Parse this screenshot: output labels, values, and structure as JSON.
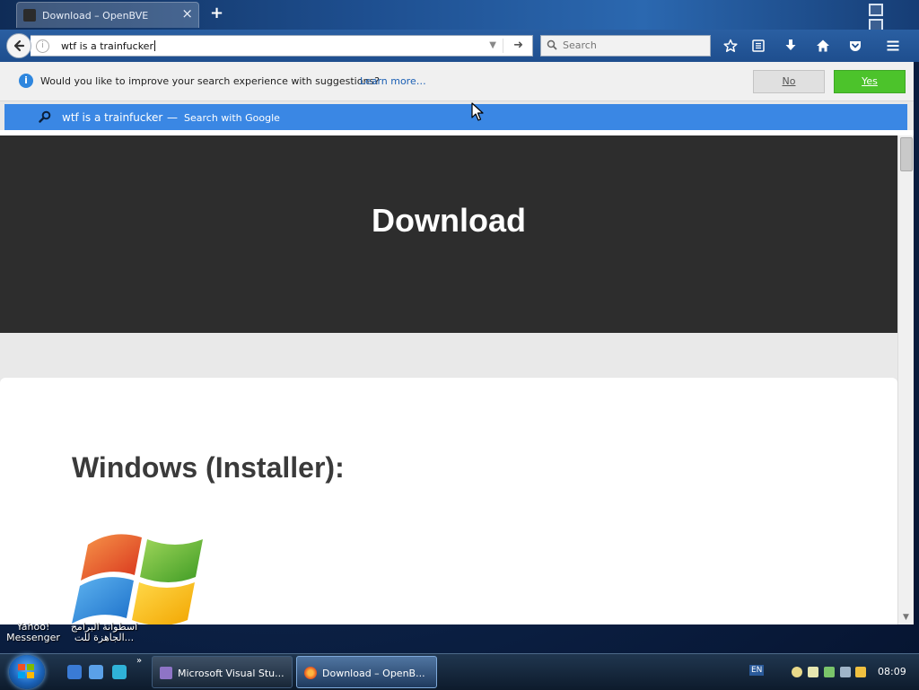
{
  "browser": {
    "tab_title": "Download – OpenBVE",
    "tab_close_glyph": "×",
    "new_tab_glyph": "+",
    "url_text": "wtf is a trainfucker",
    "search_placeholder": "Search",
    "toolbar_icons": [
      "star-bookmark-icon",
      "reading-list-icon",
      "downloads-icon",
      "home-icon",
      "pocket-icon",
      "menu-icon"
    ]
  },
  "notification": {
    "message": "Would you like to improve your search experience with suggestions?",
    "learn_more": "Learn more…",
    "no_label": "No",
    "yes_label": "Yes"
  },
  "suggestion": {
    "query": "wtf is a trainfucker",
    "separator": "—",
    "engine_text": "Search with Google"
  },
  "page": {
    "hero_title": "Download",
    "section_title": "Windows (Installer):"
  },
  "desktop": {
    "icon_labels": [
      {
        "line1": "Yahoo!",
        "line2": "Messenger"
      },
      {
        "line1": "اسطوانة البرامج",
        "line2": "الجاهزة للت..."
      }
    ]
  },
  "taskbar": {
    "quicklaunch_more": "»",
    "tasks": [
      {
        "label": "Microsoft Visual Stu...",
        "active": false
      },
      {
        "label": "Download – OpenB...",
        "active": true
      }
    ],
    "language": "EN",
    "clock": "08:09"
  },
  "colors": {
    "suggest_blue": "#3a87e4",
    "yes_green": "#4cc32b",
    "hero_bg": "#2d2d2d"
  }
}
